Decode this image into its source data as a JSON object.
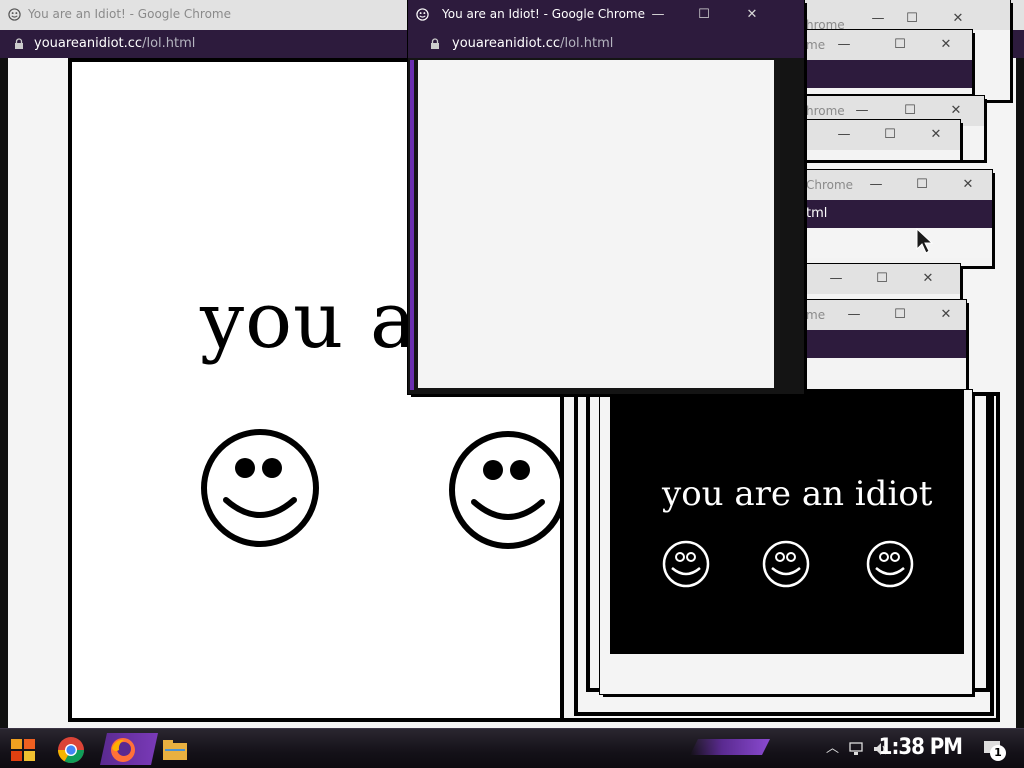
{
  "window": {
    "title": "You are an Idiot! - Google Chrome",
    "url_domain": "youareanidiot.cc",
    "url_path": "/lol.html",
    "minimize_glyph": "—",
    "maximize_glyph": "☐",
    "close_glyph": "✕"
  },
  "partial_titles": {
    "a": "hrome",
    "b": "me",
    "c": "hrome",
    "d": "Chrome",
    "e": "me"
  },
  "partial_urls": {
    "a": "tml"
  },
  "page": {
    "big_text": "you a",
    "small_text": "you are an idiot"
  },
  "taskbar": {
    "clock": "1:38 PM",
    "notification_count": "1"
  },
  "colors": {
    "titlebar_active": "#2d1b3d",
    "titlebar_inactive": "#e2e2e2",
    "accent": "#6a2fb0",
    "page_bg": "#ffffff"
  }
}
